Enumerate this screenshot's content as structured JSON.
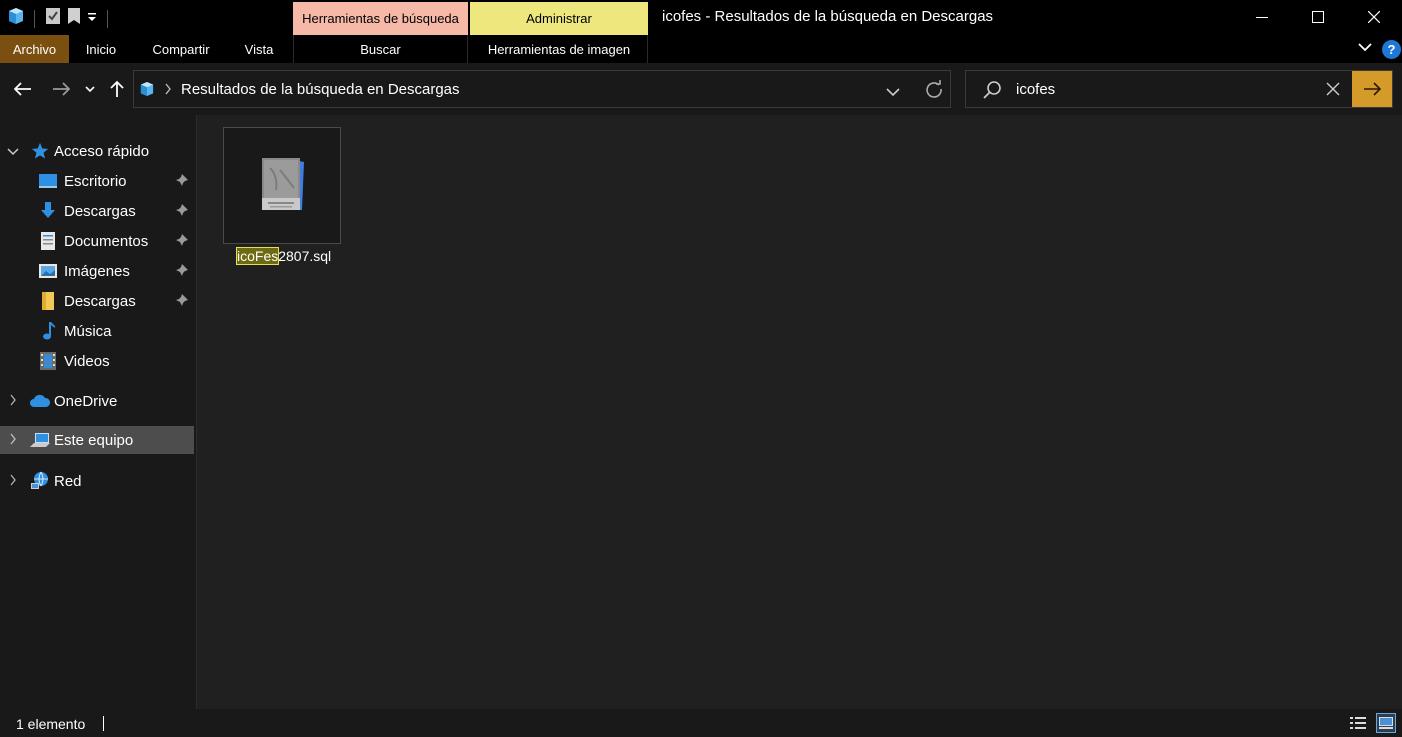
{
  "window": {
    "title": "icofes - Resultados de la búsqueda en Descargas",
    "context_tabs": {
      "search_tools": "Herramientas de búsqueda",
      "manage": "Administrar"
    },
    "controls": {
      "minimize": "—",
      "maximize": "☐",
      "close": "✕"
    }
  },
  "ribbon": {
    "tabs": {
      "file": "Archivo",
      "home": "Inicio",
      "share": "Compartir",
      "view": "Vista",
      "search": "Buscar",
      "picture_tools": "Herramientas de imagen"
    },
    "help": "?"
  },
  "navigation": {
    "back": "←",
    "forward": "→",
    "recent": "⌄",
    "up": "↑",
    "address": "Resultados de la búsqueda en Descargas",
    "search_value": "icofes",
    "clear": "✕",
    "go": "→"
  },
  "sidebar": {
    "quick_access": "Acceso rápido",
    "items": [
      {
        "label": "Escritorio",
        "icon": "desktop-icon",
        "pinned": true
      },
      {
        "label": "Descargas",
        "icon": "downloads-icon",
        "pinned": true
      },
      {
        "label": "Documentos",
        "icon": "documents-icon",
        "pinned": true
      },
      {
        "label": "Imágenes",
        "icon": "pictures-icon",
        "pinned": true
      },
      {
        "label": "Descargas",
        "icon": "folder-icon",
        "pinned": true
      },
      {
        "label": "Música",
        "icon": "music-icon",
        "pinned": false
      },
      {
        "label": "Videos",
        "icon": "videos-icon",
        "pinned": false
      }
    ],
    "onedrive": "OneDrive",
    "this_pc": "Este equipo",
    "network": "Red"
  },
  "content": {
    "file": {
      "name_match": "icoFes",
      "name_rest": "2807.sql",
      "icon": "sql-file-icon"
    }
  },
  "status": {
    "count": "1 elemento"
  },
  "colors": {
    "search_tab": "#f7b9a7",
    "manage_tab": "#ede77e",
    "file_tab": "#7a4f10",
    "go_button": "#d49b2a",
    "accent": "#1e78d6"
  }
}
